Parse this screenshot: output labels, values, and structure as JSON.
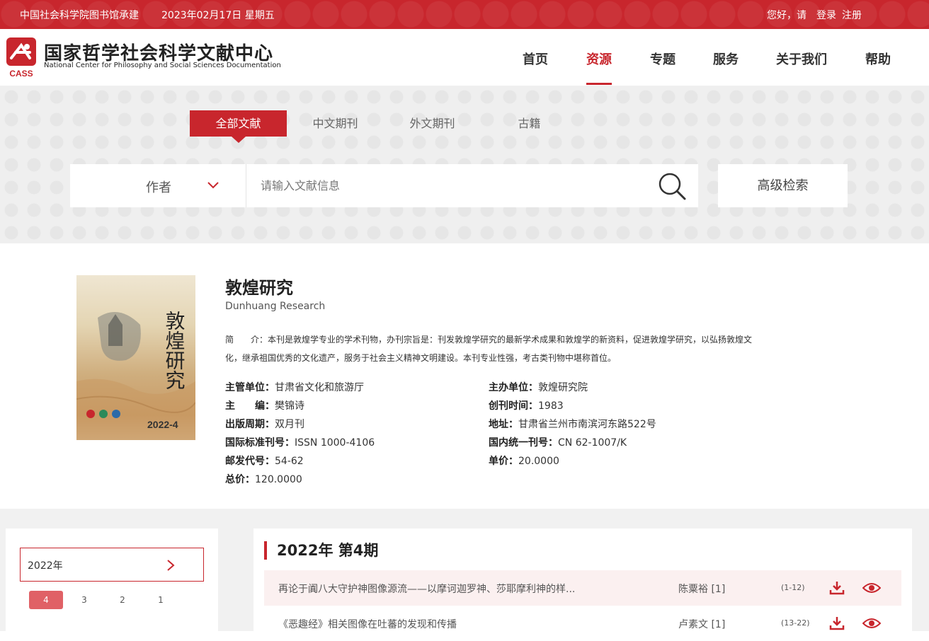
{
  "topbar": {
    "org": "中国社会科学院图书馆承建",
    "date": "2023年02月17日 星期五",
    "greeting": "您好，请",
    "login": "登录",
    "register": "注册"
  },
  "header": {
    "logo_cn": "国家哲学社会科学文献中心",
    "logo_en": "National Center for Philosophy and Social Sciences Documentation",
    "logo_abbr": "CASS",
    "nav": [
      "首页",
      "资源",
      "专题",
      "服务",
      "关于我们",
      "帮助"
    ],
    "nav_active": "资源"
  },
  "search": {
    "tabs": [
      "全部文献",
      "中文期刊",
      "外文期刊",
      "古籍"
    ],
    "active_tab": "全部文献",
    "field": "作者",
    "placeholder": "请输入文献信息",
    "advanced": "高级检索"
  },
  "journal": {
    "title": "敦煌研究",
    "title_en": "Dunhuang Research",
    "intro_label": "简　　介：",
    "intro": "本刊是敦煌学专业的学术刊物，办刊宗旨是：刊发敦煌学研究的最新学术成果和敦煌学的新资料，促进敦煌学研究，以弘扬敦煌文化，继承祖国优秀的文化遗产，服务于社会主义精神文明建设。本刊专业性强，考古类刊物中堪称首位。",
    "cover_text": "敦煌研究",
    "cover_issue": "2022-4",
    "meta": [
      {
        "k": "主管单位：",
        "v": "甘肃省文化和旅游厅"
      },
      {
        "k": "主办单位：",
        "v": "敦煌研究院"
      },
      {
        "k": "主　　编：",
        "v": "樊锦诗"
      },
      {
        "k": "创刊时间：",
        "v": "1983"
      },
      {
        "k": "出版周期：",
        "v": "双月刊"
      },
      {
        "k": "地址：",
        "v": "甘肃省兰州市南滨河东路522号"
      },
      {
        "k": "国际标准刊号：",
        "v": "ISSN 1000-4106"
      },
      {
        "k": "国内统一刊号：",
        "v": "CN 62-1007/K"
      },
      {
        "k": "邮发代号：",
        "v": "54-62"
      },
      {
        "k": "单价：",
        "v": "20.0000"
      },
      {
        "k": "总价：",
        "v": "120.0000"
      }
    ]
  },
  "issues": {
    "year": "2022年",
    "numbers": [
      "4",
      "3",
      "2",
      "1"
    ],
    "active": "4",
    "heading": "2022年 第4期",
    "articles": [
      {
        "title": "再论于阗八大守护神图像源流——以摩诃迦罗神、莎耶摩利神的样...",
        "author": "陈粟裕 [1]",
        "pages": "(1-12)"
      },
      {
        "title": "《恶趣经》相关图像在吐蕃的发现和传播",
        "author": "卢素文 [1]",
        "pages": "(13-22)"
      }
    ]
  },
  "colors": {
    "brand_red": "#c8262d",
    "issue_active": "#e06166",
    "row_highlight": "#fbf0f0"
  }
}
